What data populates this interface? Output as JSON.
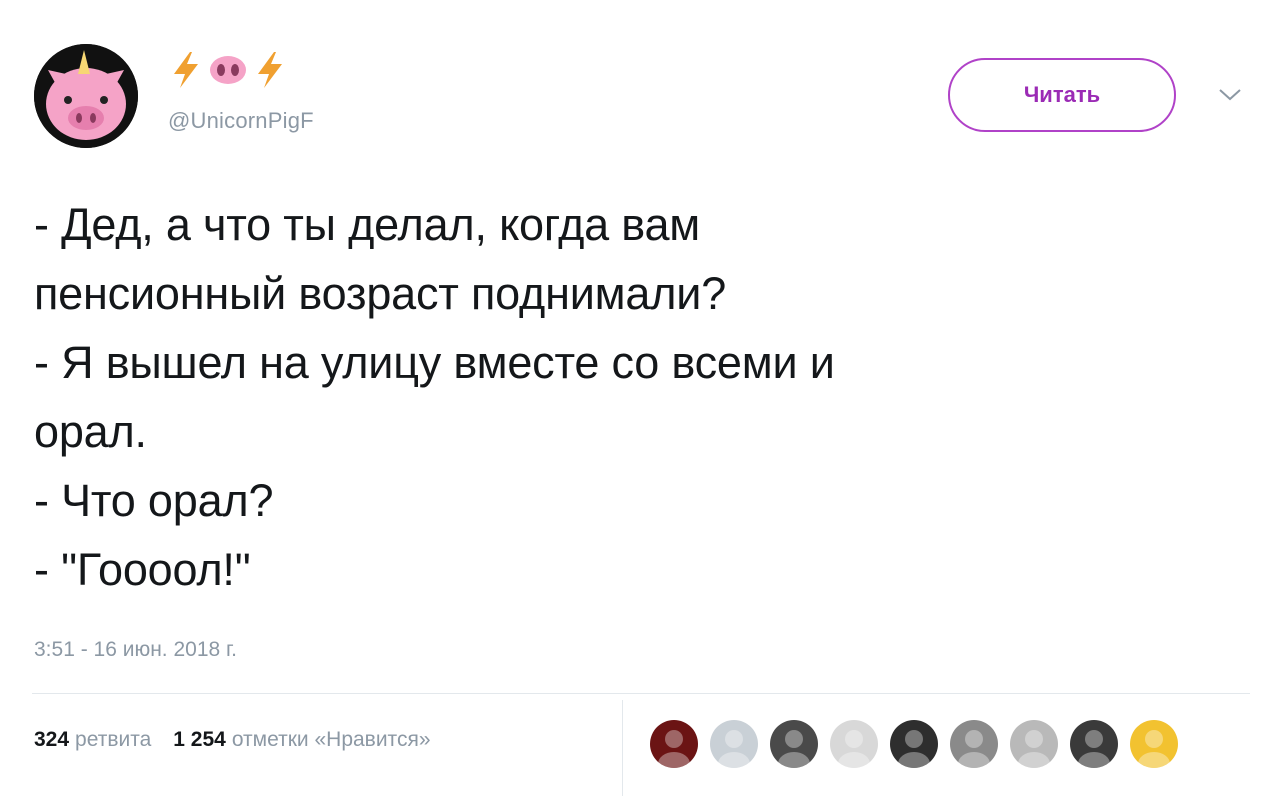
{
  "author": {
    "avatar_icon": "unicorn-pig-icon",
    "display_name_icons": [
      "lightning-icon",
      "pig-nose-icon",
      "lightning-icon"
    ],
    "handle": "@UnicornPigF"
  },
  "follow_button": {
    "label": "Читать"
  },
  "menu_icon": "chevron-down-icon",
  "tweet": {
    "lines": [
      "- Дед, а что ты делал, когда вам",
      "пенсионный возраст поднимали?",
      "- Я вышел на улицу вместе со всеми и",
      "орал.",
      "- Что орал?",
      "- \"Гоооол!\""
    ]
  },
  "timestamp": "3:51 - 16 июн. 2018 г.",
  "stats": {
    "retweets_count": "324",
    "retweets_label": "ретвита",
    "likes_count": "1 254",
    "likes_label": "отметки «Нравится»"
  },
  "likers": [
    {
      "name": "liker-avatar-1",
      "color": "#6b1414"
    },
    {
      "name": "liker-avatar-2",
      "color": "#c9d0d6"
    },
    {
      "name": "liker-avatar-3",
      "color": "#4a4a4a"
    },
    {
      "name": "liker-avatar-4",
      "color": "#d8d8d8"
    },
    {
      "name": "liker-avatar-5",
      "color": "#2e2e2e"
    },
    {
      "name": "liker-avatar-6",
      "color": "#8a8a8a"
    },
    {
      "name": "liker-avatar-7",
      "color": "#b9b9b9"
    },
    {
      "name": "liker-avatar-8",
      "color": "#3a3a3a"
    },
    {
      "name": "liker-avatar-9",
      "color": "#f2c230"
    }
  ],
  "colors": {
    "follow_accent": "#b042c8",
    "secondary_text": "#8c98a4",
    "primary_text": "#14171a",
    "pig_pink": "#f5a3c7",
    "lightning_orange": "#f0a030"
  }
}
